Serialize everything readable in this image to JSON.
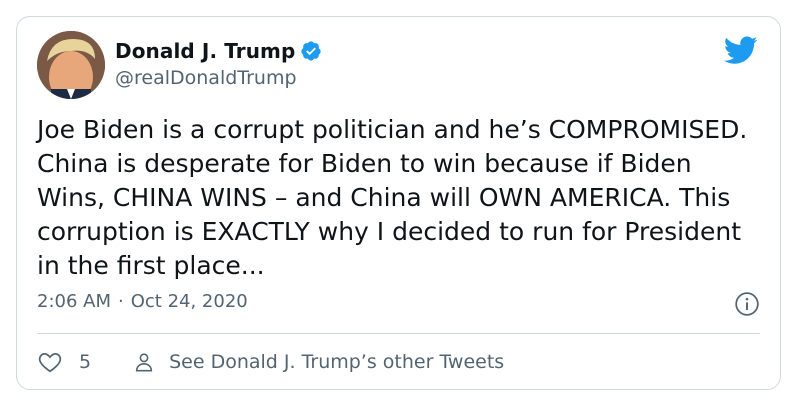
{
  "author": {
    "name": "Donald J. Trump",
    "handle": "@realDonaldTrump",
    "verified": true
  },
  "tweet": {
    "text": "Joe Biden is a corrupt politician and he’s COMPROMISED. China is desperate for Biden to win because if Biden Wins, CHINA WINS – and China will OWN AMERICA. This corruption is EXACTLY why I decided to run for President in the first place...",
    "time": "2:06 AM",
    "separator": "·",
    "date": "Oct 24, 2020"
  },
  "actions": {
    "like_count": "5",
    "see_more_label": "See Donald J. Trump’s other Tweets"
  },
  "icons": {
    "verified": "verified-badge-icon",
    "brand": "twitter-bird-icon",
    "info": "info-icon",
    "like": "heart-icon",
    "profile": "person-icon"
  },
  "colors": {
    "brand": "#1d9bf0",
    "text": "#0f1419",
    "secondary": "#536471",
    "border": "#cfd9de"
  }
}
